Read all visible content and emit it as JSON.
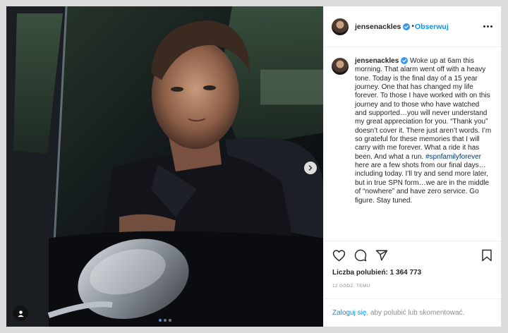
{
  "post": {
    "username": "jensenackles",
    "separator": "•",
    "follow_label": "Obserwuj",
    "caption_username": "jensenackles",
    "caption_part1": " Woke up at 6am this morning. That alarm went off with a heavy tone. Today is the final day of a 15 year journey. One that has changed my life forever. To those I have worked with on this journey and to those who have watched and supported…you will never understand my great appreciation for you. “Thank you” doesn’t cover it. There just aren’t words. I’m so grateful for these memories that I will carry with me forever. What a ride it has been. And what a run. ",
    "hashtag": "#spnfamilyforever",
    "caption_part2": " here are a few shots from our final days…including today. I’ll try and send more later, but in true SPN form…we are in the middle of “nowhere” and have zero service. Go figure. Stay tuned.",
    "likes_label": "Liczba polubień: 1 364 773",
    "timestamp": "12 GODZ. TEMU",
    "login_link": "Zaloguj się",
    "login_rest": ", aby polubić lub skomentować.",
    "carousel": {
      "count": 3,
      "active_index": 0
    }
  },
  "icons": {
    "verified": "verified-badge-icon",
    "more": "more-options-icon",
    "like": "heart-icon",
    "comment": "comment-icon",
    "share": "share-icon",
    "save": "bookmark-icon",
    "next": "chevron-right-icon",
    "tags": "user-tag-icon"
  },
  "colors": {
    "accent": "#0095f6",
    "verified": "#3897f0",
    "text": "#262626",
    "muted": "#8e8e8e"
  }
}
